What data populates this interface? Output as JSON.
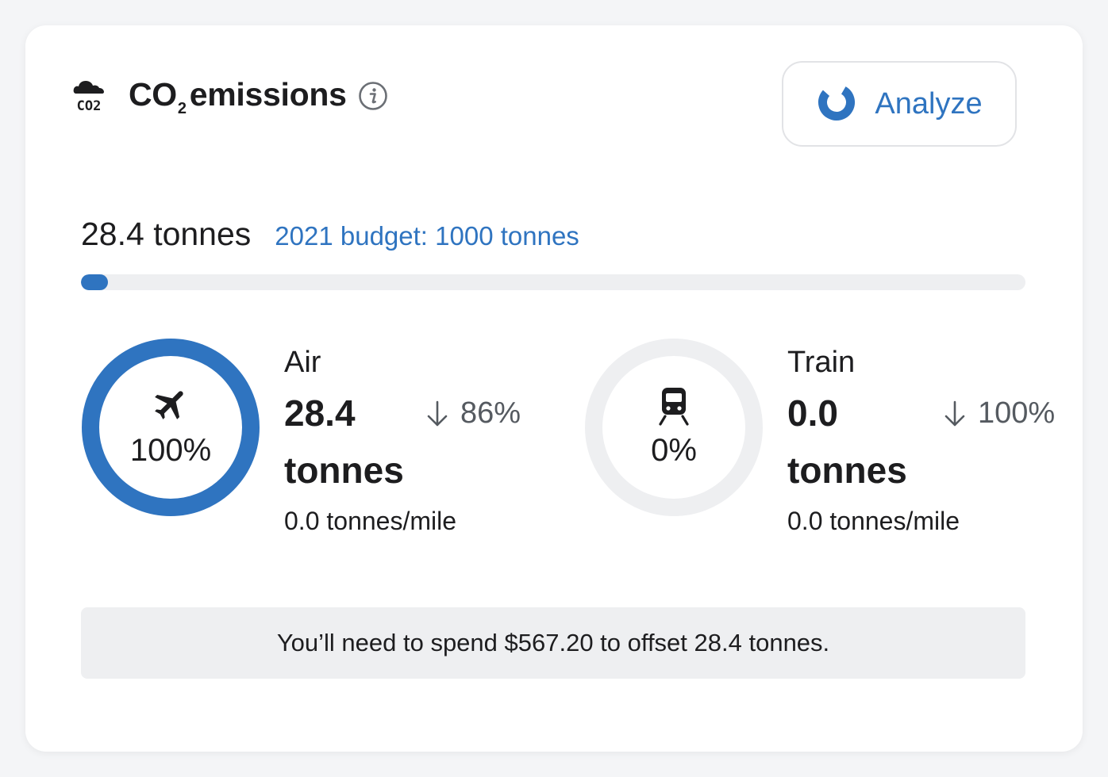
{
  "header": {
    "icon": "co2-cloud-icon",
    "icon_text": "CO2",
    "title_prefix": "CO",
    "title_subscript": "2",
    "title_suffix": "emissions",
    "info_icon": "info-icon"
  },
  "analyze": {
    "label": "Analyze",
    "icon": "pie-chart-icon",
    "color": "#2f74c0"
  },
  "summary": {
    "total": "28.4 tonnes",
    "budget": "2021 budget: 1000 tonnes",
    "progress_fraction": 0.0284
  },
  "modes": [
    {
      "name": "Air",
      "icon": "airplane-icon",
      "percent_label": "100%",
      "percent": 1.0,
      "amount": "28.4 tonnes",
      "change": "86%",
      "change_direction": "down",
      "rate": "0.0 tonnes/mile"
    },
    {
      "name": "Train",
      "icon": "train-icon",
      "percent_label": "0%",
      "percent": 0.0,
      "amount": "0.0 tonnes",
      "change": "100%",
      "change_direction": "down",
      "rate": "0.0 tonnes/mile"
    }
  ],
  "offset_note": "You’ll need to spend $567.20 to offset 28.4 tonnes.",
  "colors": {
    "accent": "#2f74c0",
    "track": "#eeeff1",
    "text": "#1d1d1f"
  }
}
